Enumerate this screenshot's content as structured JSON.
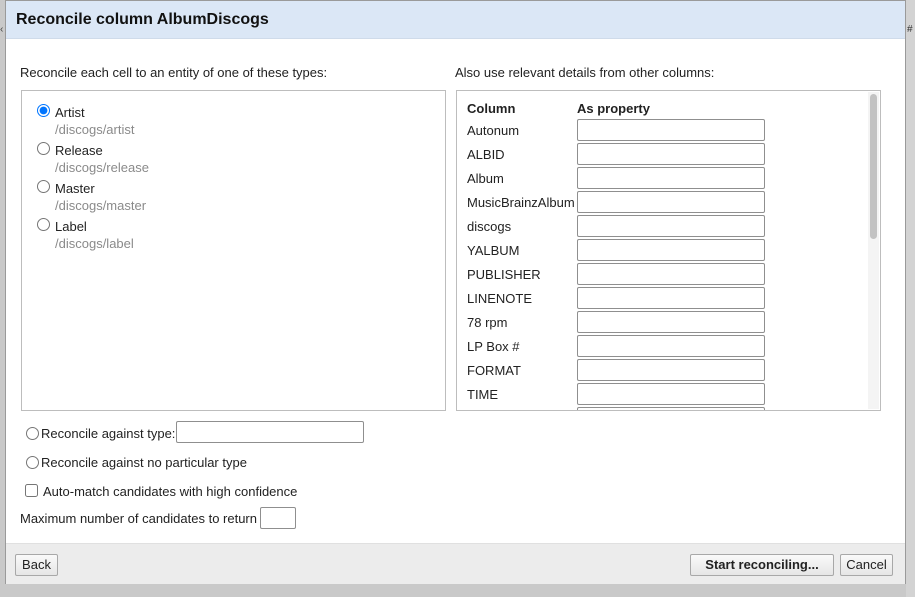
{
  "dialog": {
    "title": "Reconcile column AlbumDiscogs"
  },
  "left": {
    "label": "Reconcile each cell to an entity of one of these types:",
    "types": [
      {
        "name": "Artist",
        "id": "/discogs/artist",
        "selected": true
      },
      {
        "name": "Release",
        "id": "/discogs/release",
        "selected": false
      },
      {
        "name": "Master",
        "id": "/discogs/master",
        "selected": false
      },
      {
        "name": "Label",
        "id": "/discogs/label",
        "selected": false
      }
    ]
  },
  "right": {
    "label": "Also use relevant details from other columns:",
    "col_header": "Column",
    "prop_header": "As property",
    "columns": [
      "Autonum",
      "ALBID",
      "Album",
      "MusicBrainzAlbum",
      "discogs",
      "YALBUM",
      "PUBLISHER",
      "LINENOTE",
      "78 rpm",
      "LP Box #",
      "FORMAT",
      "TIME"
    ]
  },
  "options": {
    "against_type": "Reconcile against type:",
    "against_type_value": "",
    "no_type": "Reconcile against no particular type",
    "auto_match": "Auto-match candidates with high confidence",
    "auto_match_checked": false,
    "max_candidates": "Maximum number of candidates to return",
    "max_candidates_value": ""
  },
  "footer": {
    "back": "Back",
    "start": "Start reconciling...",
    "cancel": "Cancel"
  }
}
